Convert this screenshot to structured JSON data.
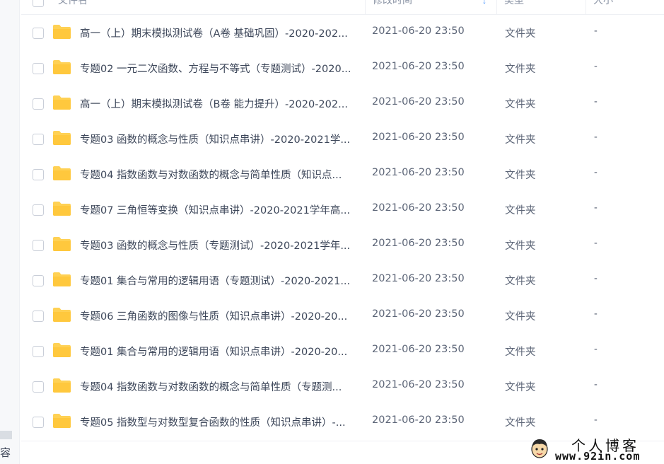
{
  "sidebar": {
    "label": "容"
  },
  "header": {
    "name": "文件名",
    "modified": "修改时间",
    "type": "类型",
    "size": "大小"
  },
  "colors": {
    "folder": "#ffd154",
    "accent": "#3b8cff"
  },
  "rows": [
    {
      "name": "高一（上）期末模拟测试卷（A卷 基础巩固）-2020-202...",
      "time": "2021-06-20 23:50",
      "type": "文件夹",
      "size": "-"
    },
    {
      "name": "专题02 一元二次函数、方程与不等式（专题测试）-2020...",
      "time": "2021-06-20 23:50",
      "type": "文件夹",
      "size": "-"
    },
    {
      "name": "高一（上）期末模拟测试卷（B卷 能力提升）-2020-202...",
      "time": "2021-06-20 23:50",
      "type": "文件夹",
      "size": "-"
    },
    {
      "name": "专题03 函数的概念与性质（知识点串讲）-2020-2021学...",
      "time": "2021-06-20 23:50",
      "type": "文件夹",
      "size": "-"
    },
    {
      "name": "专题04 指数函数与对数函数的概念与简单性质（知识点...",
      "time": "2021-06-20 23:50",
      "type": "文件夹",
      "size": "-"
    },
    {
      "name": "专题07 三角恒等变换（知识点串讲）-2020-2021学年高...",
      "time": "2021-06-20 23:50",
      "type": "文件夹",
      "size": "-"
    },
    {
      "name": "专题03 函数的概念与性质（专题测试）-2020-2021学年...",
      "time": "2021-06-20 23:50",
      "type": "文件夹",
      "size": "-"
    },
    {
      "name": "专题01 集合与常用的逻辑用语（专题测试）-2020-2021...",
      "time": "2021-06-20 23:50",
      "type": "文件夹",
      "size": "-"
    },
    {
      "name": "专题06 三角函数的图像与性质（知识点串讲）-2020-20...",
      "time": "2021-06-20 23:50",
      "type": "文件夹",
      "size": "-"
    },
    {
      "name": "专题01 集合与常用的逻辑用语（知识点串讲）-2020-20...",
      "time": "2021-06-20 23:50",
      "type": "文件夹",
      "size": "-"
    },
    {
      "name": "专题04 指数函数与对数函数的概念与简单性质（专题测...",
      "time": "2021-06-20 23:50",
      "type": "文件夹",
      "size": "-"
    },
    {
      "name": "专题05 指数型与对数型复合函数的性质（知识点串讲）-...",
      "time": "2021-06-20 23:50",
      "type": "文件夹",
      "size": "-"
    }
  ],
  "watermark": {
    "title": "个人博客",
    "url": "www.92in.com"
  }
}
